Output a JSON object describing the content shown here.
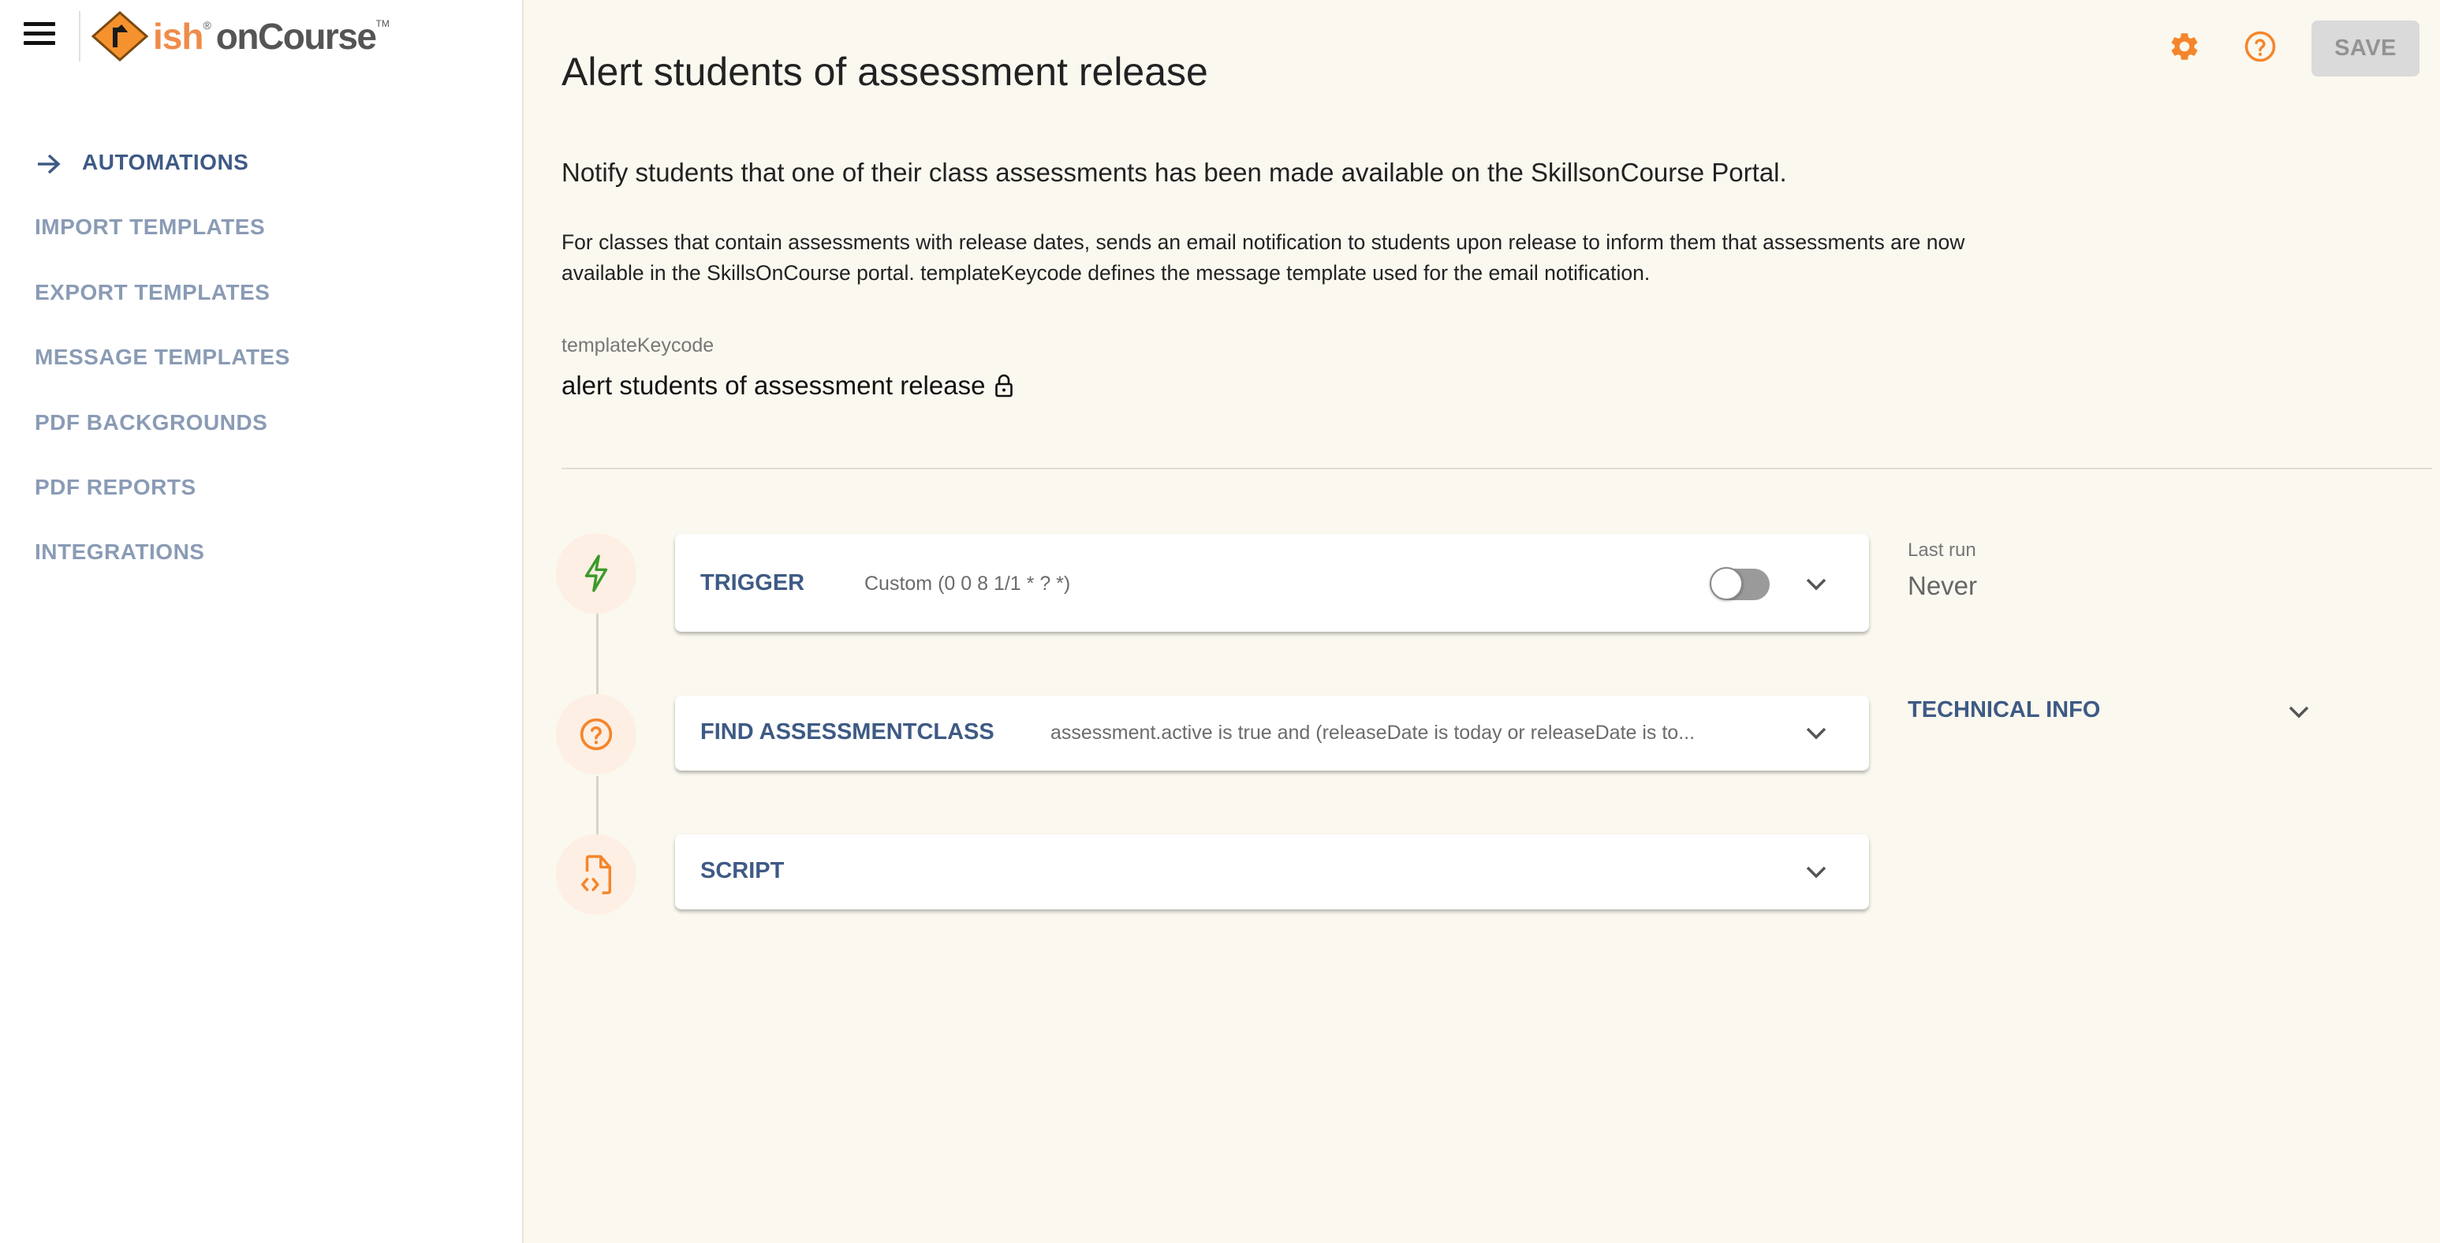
{
  "app": {
    "logo_text_ish": "ish",
    "logo_text_oncourse": "onCourse",
    "logo_reg": "®",
    "logo_tm": "TM"
  },
  "sidebar": {
    "items": [
      {
        "label": "AUTOMATIONS",
        "active": true,
        "icon": "arrow-right-icon"
      },
      {
        "label": "IMPORT TEMPLATES",
        "active": false
      },
      {
        "label": "EXPORT TEMPLATES",
        "active": false
      },
      {
        "label": "MESSAGE TEMPLATES",
        "active": false
      },
      {
        "label": "PDF BACKGROUNDS",
        "active": false
      },
      {
        "label": "PDF REPORTS",
        "active": false
      },
      {
        "label": "INTEGRATIONS",
        "active": false
      }
    ]
  },
  "header": {
    "settings_icon": "gear-icon",
    "help_icon": "help-circle-icon",
    "save_label": "SAVE",
    "accent_color": "#f5852b"
  },
  "main": {
    "title": "Alert students of assessment release",
    "subtitle": "Notify students that one of their class assessments has been made available on the SkillsonCourse Portal.",
    "description": "For classes that contain assessments with release dates, sends an email notification to students upon release to inform them that assessments are now available in the SkillsOnCourse portal. templateKeycode defines the message template used for the email notification.",
    "keycode_label": "templateKeycode",
    "keycode_value": "alert students of assessment release",
    "keycode_icon": "lock-icon"
  },
  "steps": [
    {
      "title": "TRIGGER",
      "summary": "Custom (0 0 8 1/1 * ? *)",
      "icon": "lightning-icon",
      "enabled": false
    },
    {
      "title": "FIND ASSESSMENTCLASS",
      "summary": "assessment.active is true and (releaseDate is today or releaseDate is to...",
      "icon": "help-circle-icon"
    },
    {
      "title": "SCRIPT",
      "summary": "",
      "icon": "code-file-icon"
    }
  ],
  "info": {
    "last_run_label": "Last run",
    "last_run_value": "Never",
    "technical_info_label": "TECHNICAL INFO"
  }
}
